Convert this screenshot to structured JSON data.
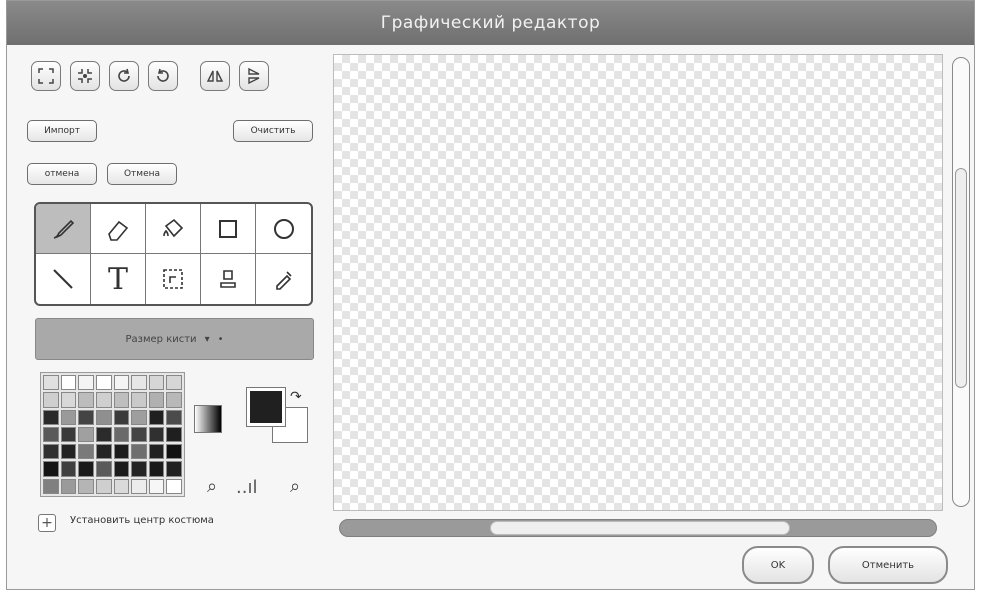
{
  "window": {
    "title": "Графический редактор"
  },
  "toolbar": {
    "icons": [
      "expand-icon",
      "shrink-icon",
      "rotate-right-icon",
      "rotate-left-icon",
      "flip-horizontal-icon",
      "flip-vertical-icon"
    ],
    "import_label": "Импорт",
    "clear_label": "Очистить",
    "undo_label": "отмена",
    "redo_label": "Отмена"
  },
  "tools": [
    "brush",
    "eraser",
    "fill",
    "rectangle",
    "ellipse",
    "line",
    "text",
    "select",
    "stamp",
    "eyedropper"
  ],
  "brush_size": {
    "label": "Размер кисти",
    "suffix": "•"
  },
  "palette": {
    "colors": [
      "#e0e0e0",
      "#ffffff",
      "#f4f4f4",
      "#ffffff",
      "#f4f4f4",
      "#e6e6e6",
      "#d6d6d6",
      "#d6d6d6",
      "#cfcfcf",
      "#d8d8d8",
      "#bcbcbc",
      "#cfcfcf",
      "#bebebe",
      "#c9c9c9",
      "#b0b0b0",
      "#b8b8b8",
      "#2a2a2a",
      "#9a9a9a",
      "#444444",
      "#8f8f8f",
      "#3b3b3b",
      "#9e9e9e",
      "#202020",
      "#4b4b4b",
      "#5a5a5a",
      "#3a3a3a",
      "#a0a0a0",
      "#2b2b2b",
      "#6a6a6a",
      "#444444",
      "#303030",
      "#1f1f1f",
      "#2f2f2f",
      "#232323",
      "#7a7a7a",
      "#242424",
      "#1c1c1c",
      "#6f6f6f",
      "#222222",
      "#111111",
      "#141414",
      "#3f3f3f",
      "#1a1a1a",
      "#5a5a5a",
      "#1b1b1b",
      "#242424",
      "#1a1a1a",
      "#202020",
      "#808080",
      "#9a9a9a",
      "#b5b5b5",
      "#cfcfcf",
      "#dadada",
      "#ececec",
      "#f6f6f6",
      "#ffffff"
    ],
    "primary": "#202020",
    "secondary": "#ffffff"
  },
  "zoom": {
    "bars": "..ıl"
  },
  "costume_center_label": "Установить центр костюма",
  "canvas": {
    "label": ""
  },
  "buttons": {
    "ok": "OK",
    "cancel": "Отменить"
  }
}
